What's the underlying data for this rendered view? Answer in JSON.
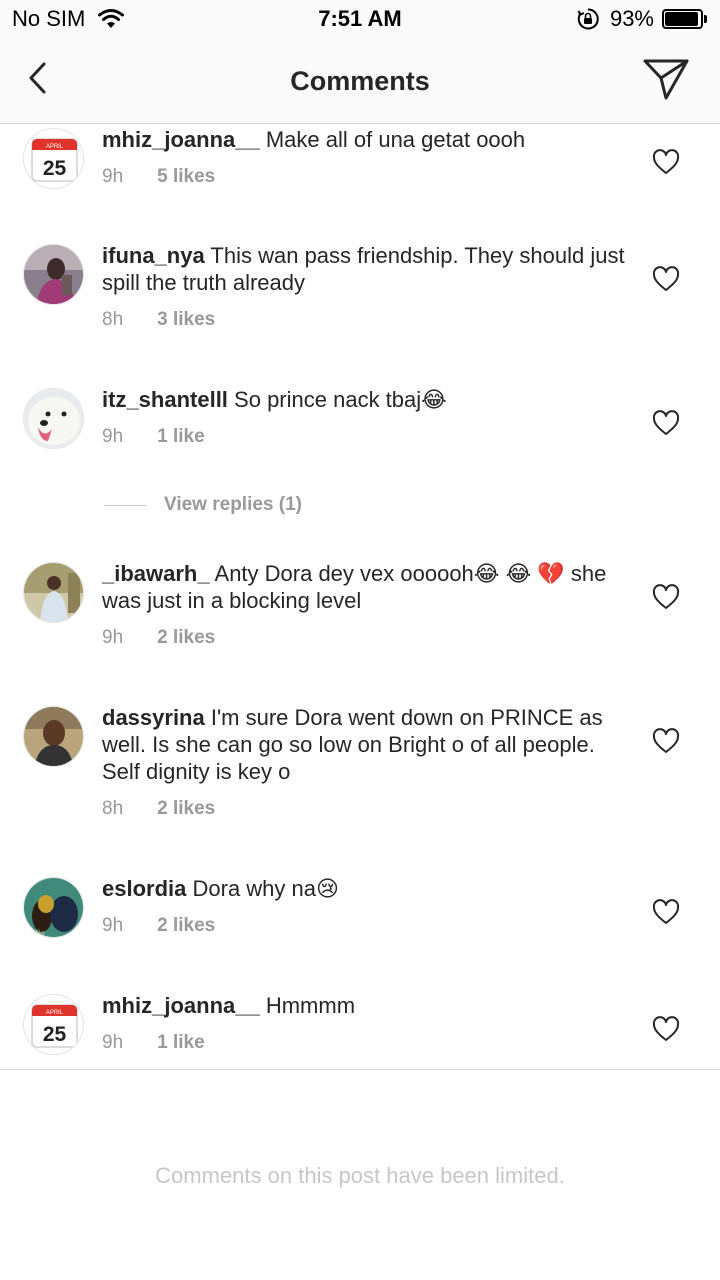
{
  "status_bar": {
    "carrier": "No SIM",
    "time": "7:51 AM",
    "battery_text": "93%",
    "battery_level": 0.93
  },
  "nav": {
    "title": "Comments",
    "back_icon": "chevron-left-icon",
    "share_icon": "paper-plane-icon"
  },
  "comments": [
    {
      "username": "mhiz_joanna__",
      "text": "Make all of una getat oooh",
      "time": "9h",
      "likes": "5 likes",
      "avatar": "calendar-icon"
    },
    {
      "username": "ifuna_nya",
      "text": "This wan pass friendship. They should just spill the truth already",
      "time": "8h",
      "likes": "3 likes",
      "avatar": "profile-photo"
    },
    {
      "username": "itz_shantelll",
      "text": "So prince nack tbaj😂",
      "time": "9h",
      "likes": "1 like",
      "avatar": "dog-photo"
    },
    {
      "username": "_ibawarh_",
      "text": "Anty Dora dey vex oooooh😂 😂 💔 she was just in a blocking level",
      "time": "9h",
      "likes": "2 likes",
      "avatar": "profile-photo"
    },
    {
      "username": "dassyrina",
      "text": "I'm sure Dora went down on PRINCE as well. Is she can go so low on Bright o  of all people.  Self dignity is key o",
      "time": "8h",
      "likes": "2 likes",
      "avatar": "profile-photo"
    },
    {
      "username": "eslordia",
      "text": "Dora why na😢",
      "time": "9h",
      "likes": "2 likes",
      "avatar": "profile-photo"
    },
    {
      "username": "mhiz_joanna__",
      "text": "Hmmmm",
      "time": "9h",
      "likes": "1 like",
      "avatar": "calendar-icon"
    }
  ],
  "calendar": {
    "month": "APRIL",
    "day": "25"
  },
  "view_replies": "View replies (1)",
  "footer": {
    "limited_text": "Comments on this post have been limited."
  },
  "colors": {
    "text": "#262626",
    "meta": "#999999",
    "calendar_red": "#e0332b"
  }
}
